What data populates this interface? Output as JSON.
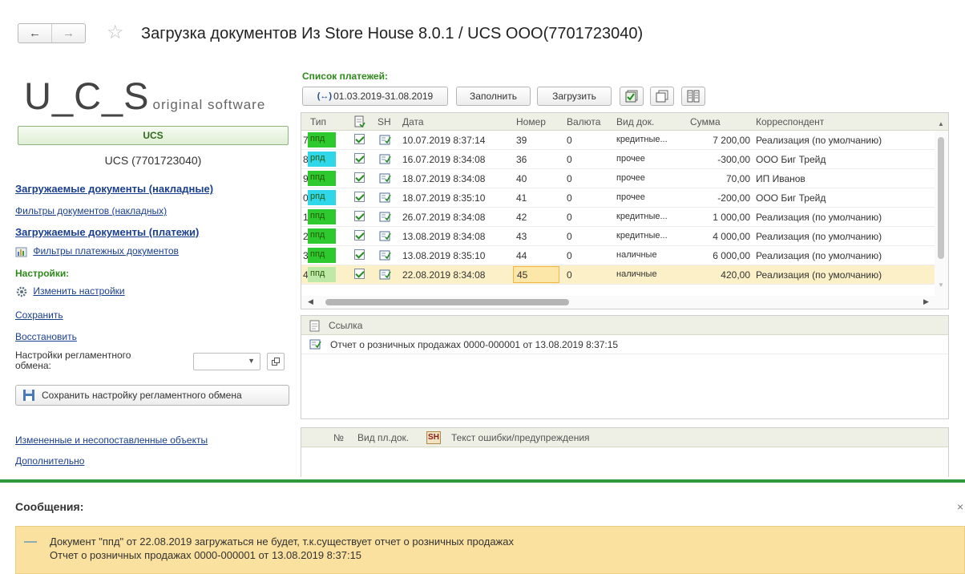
{
  "window": {
    "title": "Загрузка документов Из Store House 8.0.1   / UCS ООО(7701723040)",
    "back_glyph": "←",
    "forward_glyph": "→",
    "star_glyph": "☆"
  },
  "logo": {
    "big": "U_C_S",
    "small": "original software"
  },
  "left": {
    "org_button": "UCS",
    "org_name": "UCS (7701723040)",
    "link_invoices_docs": "Загружаемые документы (накладные)",
    "link_invoices_filters": "Фильтры документов (накладных)",
    "link_payment_docs": "Загружаемые документы (платежи)",
    "link_payment_filters": "Фильтры платежных документов",
    "settings_header": "Настройки:",
    "link_change_settings": "Изменить настройки",
    "link_save": "Сохранить",
    "link_restore": "Восстановить",
    "exchange_label": "Настройки регламентного обмена:",
    "save_exchange_button": "Сохранить настройку регламентного обмена",
    "link_changed_objects": "Измененные и несопоставленные объекты",
    "link_additional": "Дополнительно"
  },
  "payments": {
    "header": "Список платежей:",
    "period": "01.03.2019-31.08.2019",
    "fill_button": "Заполнить",
    "load_button": "Загрузить",
    "columns": {
      "type": "Тип",
      "sh": "SH",
      "date": "Дата",
      "number": "Номер",
      "currency": "Валюта",
      "doc_kind": "Вид док.",
      "sum": "Сумма",
      "correspondent": "Корреспондент"
    },
    "rows": [
      {
        "n": "7",
        "type": "ппд",
        "type_color": "#2ec92e",
        "date": "10.07.2019 8:37:14",
        "number": "39",
        "currency": "0",
        "doc_kind": "кредитные...",
        "sum": "7 200,00",
        "correspondent": "Реализация (по умолчанию)"
      },
      {
        "n": "8",
        "type": "рпд",
        "type_color": "#2fd7e8",
        "date": "16.07.2019 8:34:08",
        "number": "36",
        "currency": "0",
        "doc_kind": "прочее",
        "sum": "-300,00",
        "correspondent": "ООО Биг Трейд"
      },
      {
        "n": "9",
        "type": "ппд",
        "type_color": "#2ec92e",
        "date": "18.07.2019 8:34:08",
        "number": "40",
        "currency": "0",
        "doc_kind": "прочее",
        "sum": "70,00",
        "correspondent": "ИП Иванов"
      },
      {
        "n": "0",
        "type": "рпд",
        "type_color": "#2fd7e8",
        "date": "18.07.2019 8:35:10",
        "number": "41",
        "currency": "0",
        "doc_kind": "прочее",
        "sum": "-200,00",
        "correspondent": "ООО Биг Трейд"
      },
      {
        "n": "1",
        "type": "ппд",
        "type_color": "#2ec92e",
        "date": "26.07.2019 8:34:08",
        "number": "42",
        "currency": "0",
        "doc_kind": "кредитные...",
        "sum": "1 000,00",
        "correspondent": "Реализация (по умолчанию)"
      },
      {
        "n": "2",
        "type": "ппд",
        "type_color": "#2ec92e",
        "date": "13.08.2019 8:34:08",
        "number": "43",
        "currency": "0",
        "doc_kind": "кредитные...",
        "sum": "4 000,00",
        "correspondent": "Реализация (по умолчанию)"
      },
      {
        "n": "3",
        "type": "ппд",
        "type_color": "#2ec92e",
        "date": "13.08.2019 8:35:10",
        "number": "44",
        "currency": "0",
        "doc_kind": "наличные",
        "sum": "6 000,00",
        "correspondent": "Реализация (по умолчанию)"
      },
      {
        "n": "4",
        "type": "ппд",
        "type_color": "#bfe9a6",
        "date": "22.08.2019 8:34:08",
        "number": "45",
        "currency": "0",
        "doc_kind": "наличные",
        "sum": "420,00",
        "correspondent": "Реализация (по умолчанию)",
        "selected": true
      }
    ]
  },
  "links_panel": {
    "header": "Ссылка",
    "row": "Отчет о розничных продажах 0000-000001 от 13.08.2019 8:37:15"
  },
  "errors_panel": {
    "col_no": "№",
    "col_kind": "Вид пл.док.",
    "col_text": "Текст ошибки/предупреждения"
  },
  "messages": {
    "title": "Сообщения:",
    "close": "×",
    "dash": "—",
    "line1": "Документ \"ппд\" от 22.08.2019 загружаться не будет, т.к.существует отчет о розничных продажах",
    "line2": "Отчет о розничных продажах 0000-000001 от 13.08.2019 8:37:15"
  }
}
